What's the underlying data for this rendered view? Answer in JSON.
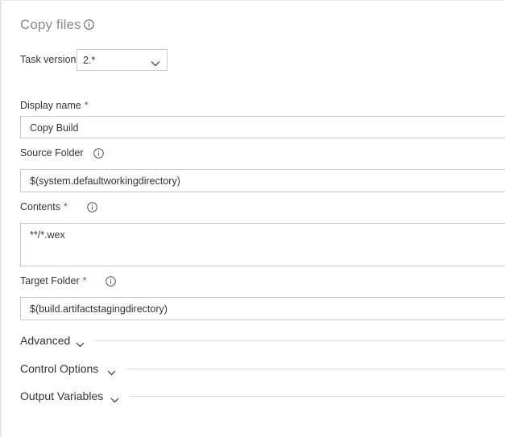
{
  "task": {
    "title": "Copy files",
    "version_label": "Task version",
    "version_value": "2.*"
  },
  "fields": {
    "display_name": {
      "label": "Display name",
      "required": "*",
      "value": "Copy Build"
    },
    "source_folder": {
      "label": "Source Folder",
      "value": "$(system.defaultworkingdirectory)"
    },
    "contents": {
      "label": "Contents",
      "required": "*",
      "value": "**/*.wex"
    },
    "target_folder": {
      "label": "Target Folder",
      "required": "*",
      "value": "$(build.artifactstagingdirectory)"
    }
  },
  "sections": {
    "advanced": "Advanced",
    "control_options": "Control Options",
    "output_variables": "Output Variables"
  },
  "colors": {
    "required": "#c4314b",
    "border": "#c8c8c8",
    "title": "#8a8a8a"
  },
  "icons": [
    "info-icon",
    "chevron-down-icon"
  ]
}
